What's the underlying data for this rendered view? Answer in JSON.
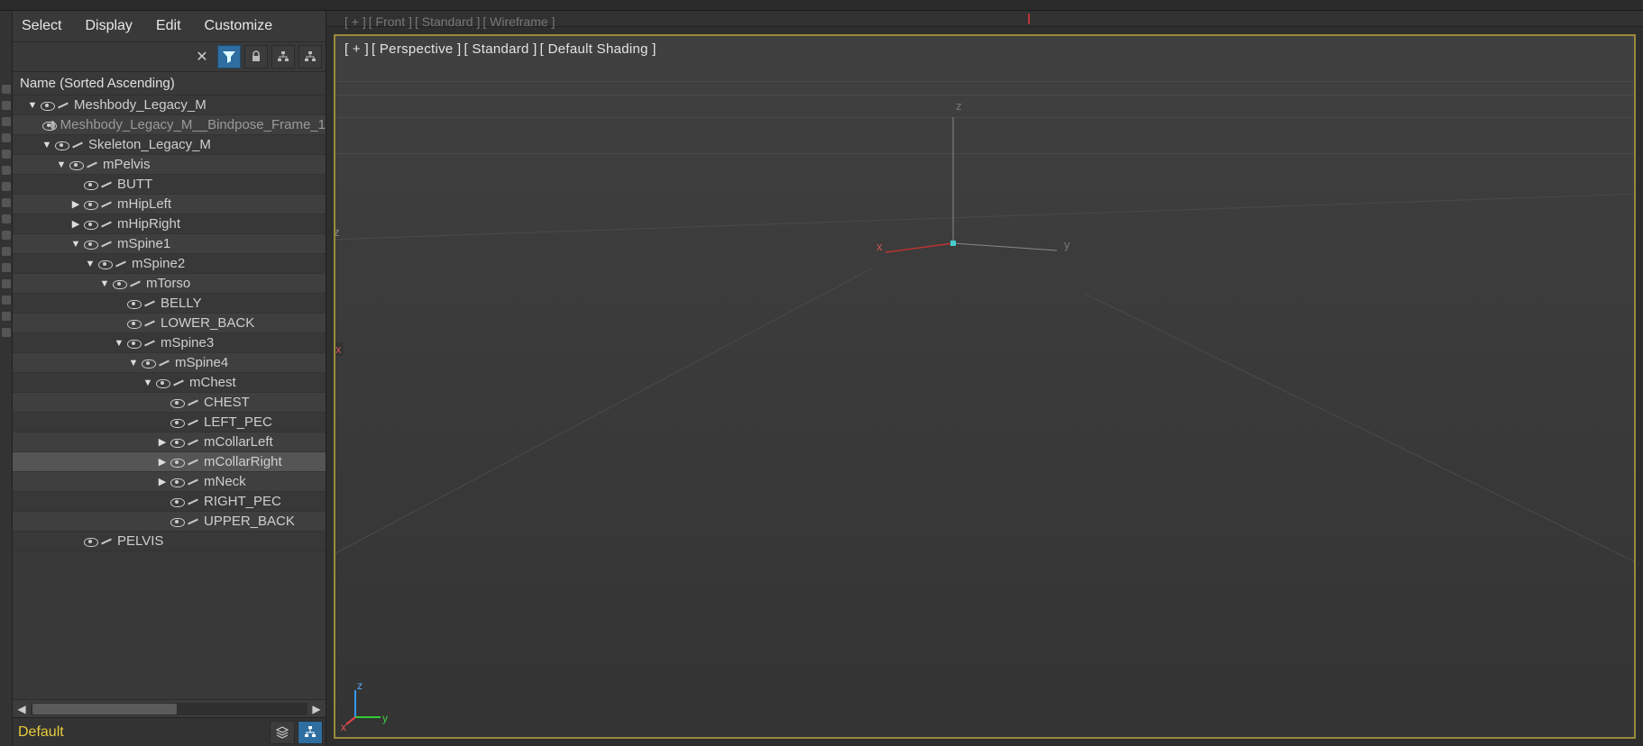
{
  "menubar": {
    "items": [
      "Select",
      "Display",
      "Edit",
      "Customize"
    ]
  },
  "toolbar": {
    "close": "✕",
    "filter": "funnel-icon",
    "lock": "lock-icon",
    "hier1": "hierarchy-icon",
    "hier2": "hierarchy-icon"
  },
  "tree": {
    "header": "Name (Sorted Ascending)",
    "rows": [
      {
        "depth": 0,
        "chev": "down",
        "label": "Meshbody_Legacy_M",
        "icon": "bone",
        "alt": false
      },
      {
        "depth": 2,
        "chev": "",
        "label": "Meshbody_Legacy_M__Bindpose_Frame_1",
        "icon": "dot",
        "alt": true,
        "faded": true
      },
      {
        "depth": 1,
        "chev": "down",
        "label": "Skeleton_Legacy_M",
        "icon": "bone",
        "alt": false
      },
      {
        "depth": 2,
        "chev": "down",
        "label": "mPelvis",
        "icon": "bone",
        "alt": true
      },
      {
        "depth": 3,
        "chev": "",
        "label": "BUTT",
        "icon": "bone",
        "alt": false
      },
      {
        "depth": 3,
        "chev": "right",
        "label": "mHipLeft",
        "icon": "bone",
        "alt": true
      },
      {
        "depth": 3,
        "chev": "right",
        "label": "mHipRight",
        "icon": "bone",
        "alt": false
      },
      {
        "depth": 3,
        "chev": "down",
        "label": "mSpine1",
        "icon": "bone",
        "alt": true
      },
      {
        "depth": 4,
        "chev": "down",
        "label": "mSpine2",
        "icon": "bone",
        "alt": false
      },
      {
        "depth": 5,
        "chev": "down",
        "label": "mTorso",
        "icon": "bone",
        "alt": true
      },
      {
        "depth": 6,
        "chev": "",
        "label": "BELLY",
        "icon": "bone",
        "alt": false
      },
      {
        "depth": 6,
        "chev": "",
        "label": "LOWER_BACK",
        "icon": "bone",
        "alt": true
      },
      {
        "depth": 6,
        "chev": "down",
        "label": "mSpine3",
        "icon": "bone",
        "alt": false
      },
      {
        "depth": 7,
        "chev": "down",
        "label": "mSpine4",
        "icon": "bone",
        "alt": true
      },
      {
        "depth": 8,
        "chev": "down",
        "label": "mChest",
        "icon": "bone",
        "alt": false
      },
      {
        "depth": 9,
        "chev": "",
        "label": "CHEST",
        "icon": "bone",
        "alt": true
      },
      {
        "depth": 9,
        "chev": "",
        "label": "LEFT_PEC",
        "icon": "bone",
        "alt": false
      },
      {
        "depth": 9,
        "chev": "right",
        "label": "mCollarLeft",
        "icon": "bone",
        "alt": true
      },
      {
        "depth": 9,
        "chev": "right",
        "label": "mCollarRight",
        "icon": "bone",
        "alt": false,
        "sel": true
      },
      {
        "depth": 9,
        "chev": "right",
        "label": "mNeck",
        "icon": "bone",
        "alt": true
      },
      {
        "depth": 9,
        "chev": "",
        "label": "RIGHT_PEC",
        "icon": "bone",
        "alt": false
      },
      {
        "depth": 9,
        "chev": "",
        "label": "UPPER_BACK",
        "icon": "bone",
        "alt": true
      },
      {
        "depth": 3,
        "chev": "",
        "label": "PELVIS",
        "icon": "bone",
        "alt": false
      }
    ]
  },
  "status": {
    "label": "Default"
  },
  "viewport": {
    "label_plus": "[ + ]",
    "label_view": "[ Perspective ]",
    "label_render": "[ Standard ]",
    "label_shading": "[ Default Shading ]",
    "faded_plus": "[ + ]",
    "faded_view": "[ Front ]",
    "faded_render": "[ Standard ]",
    "faded_shading": "[ Wireframe ]",
    "axis_x": "x",
    "axis_y": "y",
    "axis_z": "z",
    "gizmo_x": "x",
    "gizmo_y": "y",
    "gizmo_z": "z"
  }
}
